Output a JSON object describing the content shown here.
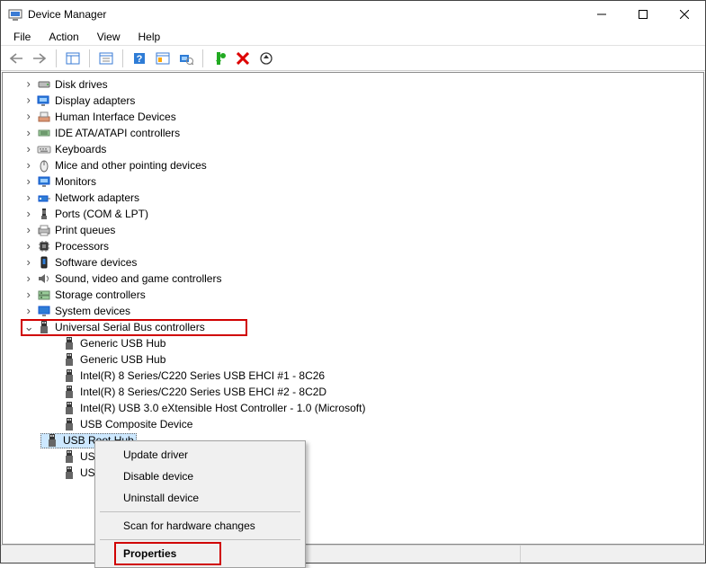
{
  "window": {
    "title": "Device Manager"
  },
  "menubar": [
    "File",
    "Action",
    "View",
    "Help"
  ],
  "categories": [
    {
      "label": "Disk drives",
      "icon": "disk-drive-icon"
    },
    {
      "label": "Display adapters",
      "icon": "display-adapter-icon"
    },
    {
      "label": "Human Interface Devices",
      "icon": "hid-icon"
    },
    {
      "label": "IDE ATA/ATAPI controllers",
      "icon": "ide-controller-icon"
    },
    {
      "label": "Keyboards",
      "icon": "keyboard-icon"
    },
    {
      "label": "Mice and other pointing devices",
      "icon": "mouse-icon"
    },
    {
      "label": "Monitors",
      "icon": "monitor-icon"
    },
    {
      "label": "Network adapters",
      "icon": "network-adapter-icon"
    },
    {
      "label": "Ports (COM & LPT)",
      "icon": "port-icon"
    },
    {
      "label": "Print queues",
      "icon": "print-queue-icon"
    },
    {
      "label": "Processors",
      "icon": "processor-icon"
    },
    {
      "label": "Software devices",
      "icon": "software-device-icon"
    },
    {
      "label": "Sound, video and game controllers",
      "icon": "sound-controller-icon"
    },
    {
      "label": "Storage controllers",
      "icon": "storage-controller-icon"
    },
    {
      "label": "System devices",
      "icon": "system-device-icon"
    }
  ],
  "usb_category": {
    "label": "Universal Serial Bus controllers"
  },
  "usb_children": [
    "Generic USB Hub",
    "Generic USB Hub",
    "Intel(R) 8 Series/C220 Series USB EHCI #1 - 8C26",
    "Intel(R) 8 Series/C220 Series USB EHCI #2 - 8C2D",
    "Intel(R) USB 3.0 eXtensible Host Controller - 1.0 (Microsoft)",
    "USB Composite Device",
    "USB Root Hub",
    "US",
    "US"
  ],
  "context_menu": {
    "update": "Update driver",
    "disable": "Disable device",
    "uninstall": "Uninstall device",
    "scan": "Scan for hardware changes",
    "properties": "Properties"
  }
}
